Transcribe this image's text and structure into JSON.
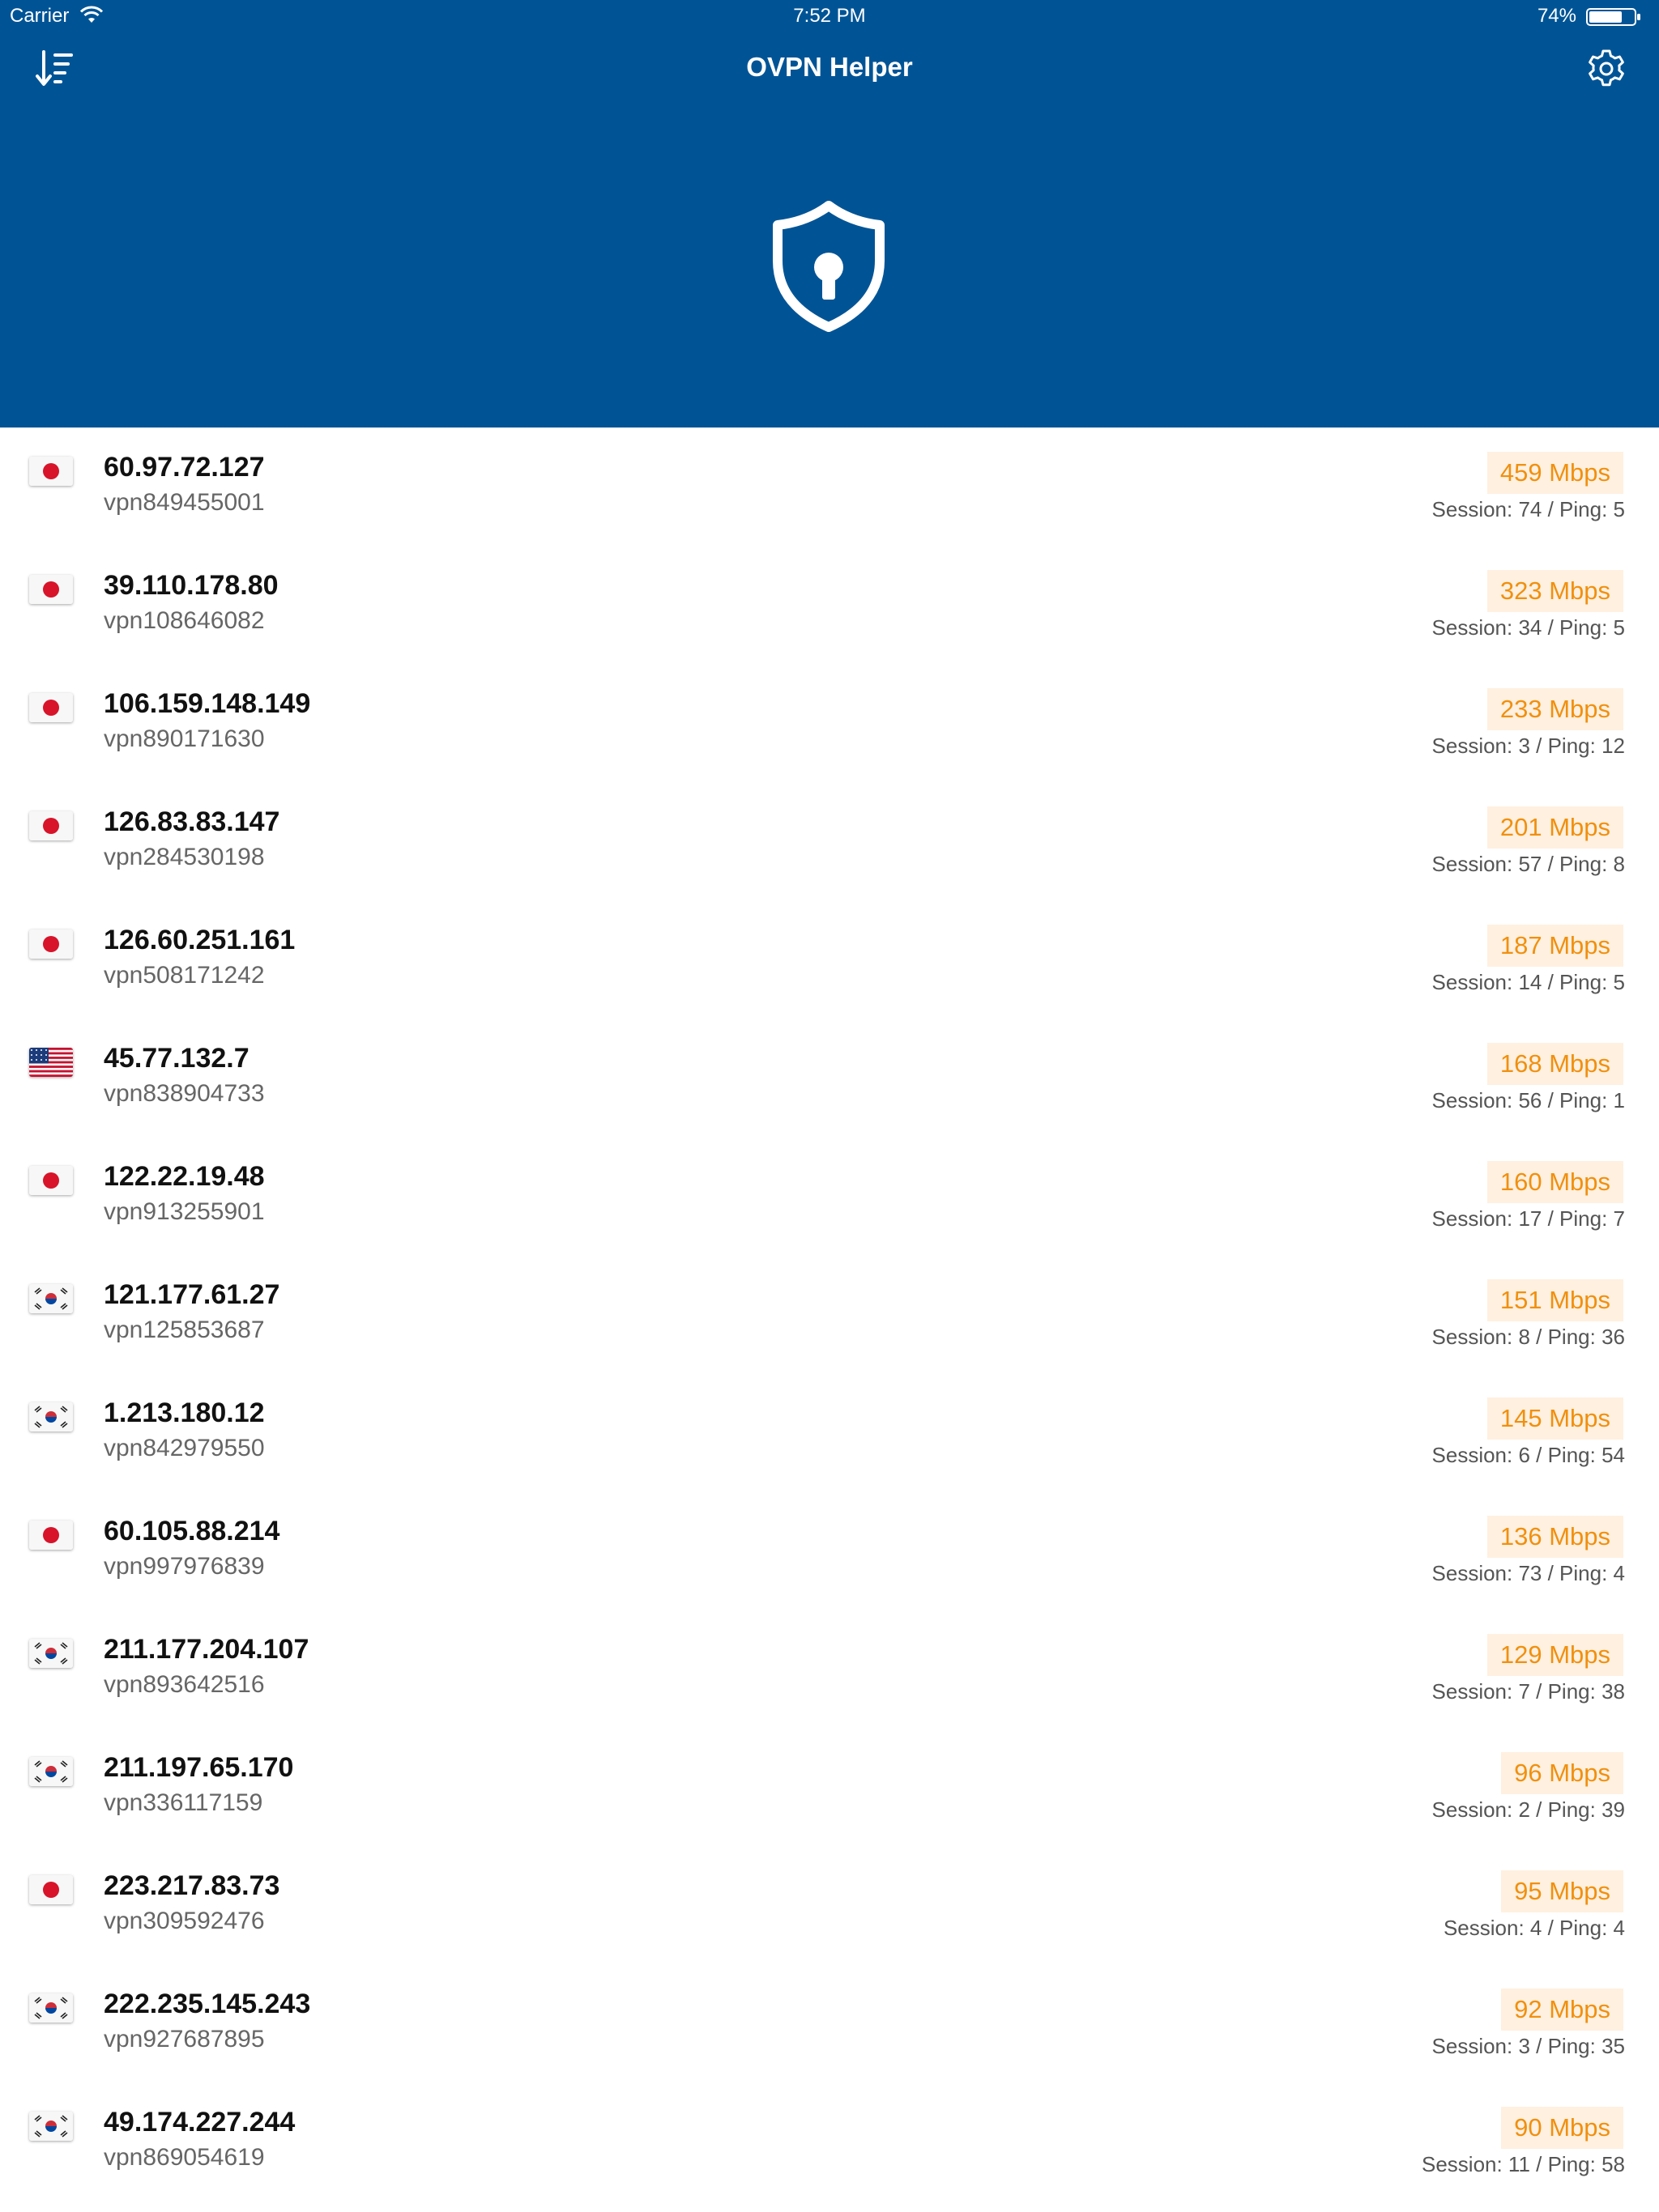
{
  "status_bar": {
    "carrier": "Carrier",
    "time": "7:52 PM",
    "battery": "74%"
  },
  "header": {
    "title": "OVPN Helper",
    "background_color": "#005496",
    "sort_icon": "sort-descending-icon",
    "settings_icon": "gear-icon",
    "logo_icon": "shield-lock-icon"
  },
  "accent_color": "#f0900f",
  "servers": [
    {
      "flag": "jp",
      "ip": "60.97.72.127",
      "host": "vpn849455001",
      "speed": "459 Mbps",
      "stats": "Session: 74 / Ping: 5"
    },
    {
      "flag": "jp",
      "ip": "39.110.178.80",
      "host": "vpn108646082",
      "speed": "323 Mbps",
      "stats": "Session: 34 / Ping: 5"
    },
    {
      "flag": "jp",
      "ip": "106.159.148.149",
      "host": "vpn890171630",
      "speed": "233 Mbps",
      "stats": "Session: 3 / Ping: 12"
    },
    {
      "flag": "jp",
      "ip": "126.83.83.147",
      "host": "vpn284530198",
      "speed": "201 Mbps",
      "stats": "Session: 57 / Ping: 8"
    },
    {
      "flag": "jp",
      "ip": "126.60.251.161",
      "host": "vpn508171242",
      "speed": "187 Mbps",
      "stats": "Session: 14 / Ping: 5"
    },
    {
      "flag": "us",
      "ip": "45.77.132.7",
      "host": "vpn838904733",
      "speed": "168 Mbps",
      "stats": "Session: 56 / Ping: 1"
    },
    {
      "flag": "jp",
      "ip": "122.22.19.48",
      "host": "vpn913255901",
      "speed": "160 Mbps",
      "stats": "Session: 17 / Ping: 7"
    },
    {
      "flag": "kr",
      "ip": "121.177.61.27",
      "host": "vpn125853687",
      "speed": "151 Mbps",
      "stats": "Session: 8 / Ping: 36"
    },
    {
      "flag": "kr",
      "ip": "1.213.180.12",
      "host": "vpn842979550",
      "speed": "145 Mbps",
      "stats": "Session: 6 / Ping: 54"
    },
    {
      "flag": "jp",
      "ip": "60.105.88.214",
      "host": "vpn997976839",
      "speed": "136 Mbps",
      "stats": "Session: 73 / Ping: 4"
    },
    {
      "flag": "kr",
      "ip": "211.177.204.107",
      "host": "vpn893642516",
      "speed": "129 Mbps",
      "stats": "Session: 7 / Ping: 38"
    },
    {
      "flag": "kr",
      "ip": "211.197.65.170",
      "host": "vpn336117159",
      "speed": "96 Mbps",
      "stats": "Session: 2 / Ping: 39"
    },
    {
      "flag": "jp",
      "ip": "223.217.83.73",
      "host": "vpn309592476",
      "speed": "95 Mbps",
      "stats": "Session: 4 / Ping: 4"
    },
    {
      "flag": "kr",
      "ip": "222.235.145.243",
      "host": "vpn927687895",
      "speed": "92 Mbps",
      "stats": "Session: 3 / Ping: 35"
    },
    {
      "flag": "kr",
      "ip": "49.174.227.244",
      "host": "vpn869054619",
      "speed": "90 Mbps",
      "stats": "Session: 11 / Ping: 58"
    }
  ]
}
